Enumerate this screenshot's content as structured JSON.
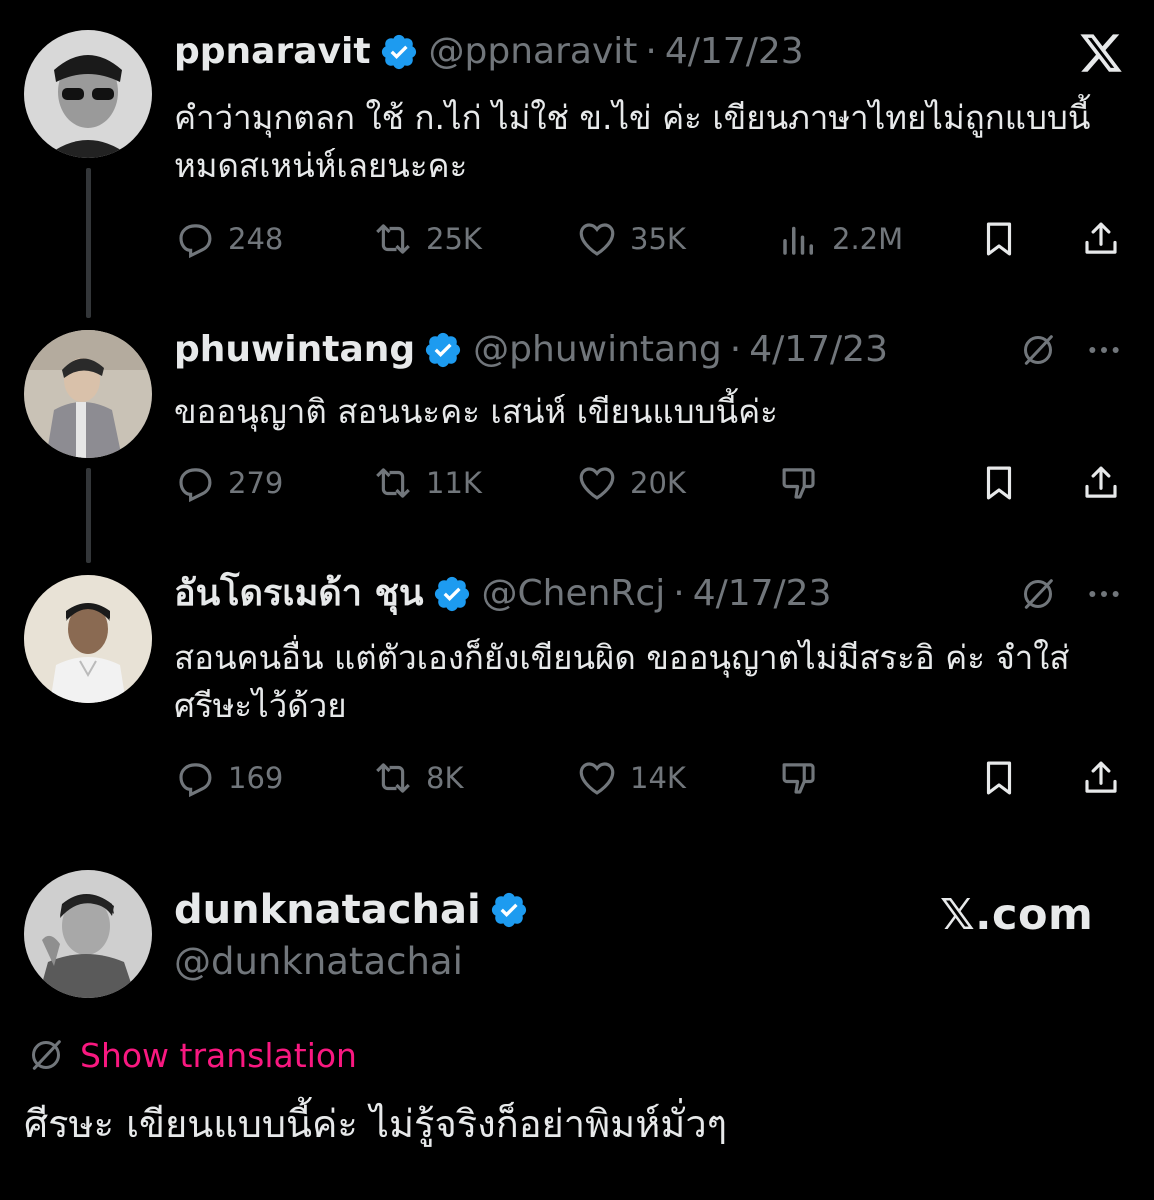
{
  "tweets": [
    {
      "name": "ppnaravit",
      "handle": "@ppnaravit",
      "date": "4/17/23",
      "text": "คำว่ามุกตลก ใช้ ก.ไก่ ไม่ใช่ ข.ไข่ ค่ะ เขียนภาษาไทยไม่ถูกแบบนี้ หมดสเหน่ห์เลยนะคะ",
      "replies": "248",
      "reposts": "25K",
      "likes": "35K",
      "views": "2.2M"
    },
    {
      "name": "phuwintang",
      "handle": "@phuwintang",
      "date": "4/17/23",
      "text": "ขออนุญาติ สอนนะคะ เสน่ห์ เขียนแบบนี้ค่ะ",
      "replies": "279",
      "reposts": "11K",
      "likes": "20K"
    },
    {
      "name": "อันโดรเมด้า ชุน",
      "handle": "@ChenRcj",
      "date": "4/17/23",
      "text": "สอนคนอื่น แต่ตัวเองก็ยังเขียนผิด ขออนุญาตไม่มีสระอิ ค่ะ จำใส่ศรีษะไว้ด้วย",
      "replies": "169",
      "reposts": "8K",
      "likes": "14K"
    }
  ],
  "main_tweet": {
    "name": "dunknatachai",
    "handle": "@dunknatachai",
    "watermark": "𝕏.com",
    "show_translation": "Show translation",
    "text": "ศีรษะ เขียนแบบนี้ค่ะ ไม่รู้จริงก็อย่าพิมห์มั่วๆ"
  },
  "separator": "·",
  "colors": {
    "background": "#000000",
    "text": "#e7e9ea",
    "muted": "#71767b",
    "verified": "#1d9bf0",
    "translation": "#f91880"
  },
  "icons": [
    "x-logo-icon",
    "verified-icon",
    "reply-icon",
    "repost-icon",
    "like-icon",
    "views-icon",
    "bookmark-icon",
    "share-icon",
    "grok-icon",
    "more-icon",
    "dislike-icon",
    "globe-icon"
  ]
}
